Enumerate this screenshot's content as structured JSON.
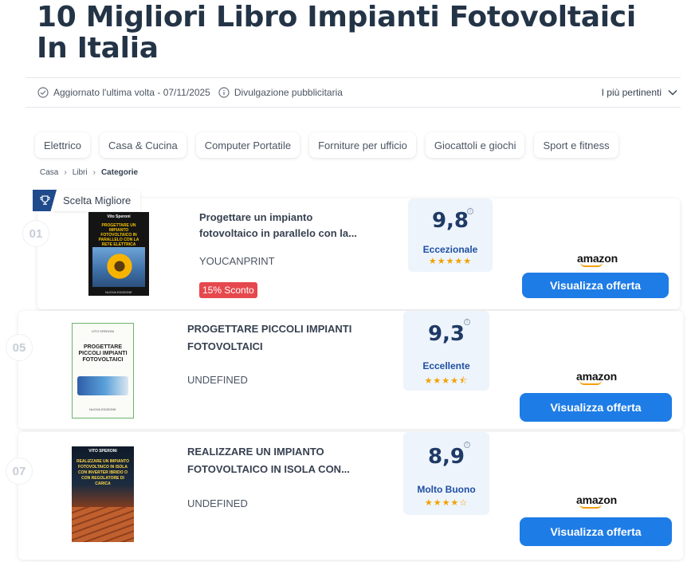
{
  "page": {
    "title": "10 Migliori Libro Impianti Fotovoltaici In Italia"
  },
  "meta": {
    "updated": "Aggiornato l'ultima volta - 07/11/2025",
    "disclosure": "Divulgazione pubblicitaria",
    "sort_label": "I più pertinenti"
  },
  "categories": [
    "Elettrico",
    "Casa & Cucina",
    "Computer Portatile",
    "Forniture per ufficio",
    "Giocattoli e giochi",
    "Sport e fitness"
  ],
  "breadcrumb": [
    "Casa",
    "Libri",
    "Categorie"
  ],
  "ribbon": {
    "label": "Scelta Migliore"
  },
  "products": [
    {
      "rank": "01",
      "title_line1": "Progettare un impianto",
      "title_line2": "fotovoltaico in parallelo con la...",
      "brand": "YOUCANPRINT",
      "discount": "15% Sconto",
      "score": "9,8",
      "verdict": "Eccezionale",
      "stars": "★★★★★",
      "rating_stars": 5,
      "store": "amazon",
      "cta": "Visualizza offerta",
      "cover": {
        "author": "Vito Speroni",
        "title": "PROGETTARE UN IMPIANTO FOTOVOLTAICO IN PARALLELO CON LA RETE ELETTRICA",
        "footer": "NUOVA EDIZIONE"
      }
    },
    {
      "rank": "05",
      "title_line1": "PROGETTARE PICCOLI IMPIANTI",
      "title_line2": "FOTOVOLTAICI",
      "brand": "UNDEFINED",
      "score": "9,3",
      "verdict": "Eccellente",
      "stars": "★★★★⯪",
      "rating_stars": 4.5,
      "store": "amazon",
      "cta": "Visualizza offerta",
      "cover": {
        "author": "VITO SPERONI",
        "title": "PROGETTARE PICCOLI IMPIANTI FOTOVOLTAICI",
        "footer": "NUOVA EDIZIONE"
      }
    },
    {
      "rank": "07",
      "title_line1": "REALIZZARE UN IMPIANTO",
      "title_line2": "FOTOVOLTAICO IN ISOLA CON...",
      "brand": "UNDEFINED",
      "score": "8,9",
      "verdict": "Molto Buono",
      "stars": "★★★★☆",
      "rating_stars": 4,
      "store": "amazon",
      "cta": "Visualizza offerta",
      "cover": {
        "author": "VITO SPERONI",
        "title": "REALIZZARE UN IMPIANTO FOTOVOLTAICO IN ISOLA CON INVERTER IBRIDO O CON REGOLATORE DI CARICA"
      }
    }
  ],
  "colors": {
    "title": "#243447",
    "cta": "#1e7ce6",
    "discount": "#e5484d",
    "score": "#1e3a66",
    "verdict": "#1e4fa3",
    "stars": "#f2a100",
    "ribbon": "#1f4a8c"
  }
}
